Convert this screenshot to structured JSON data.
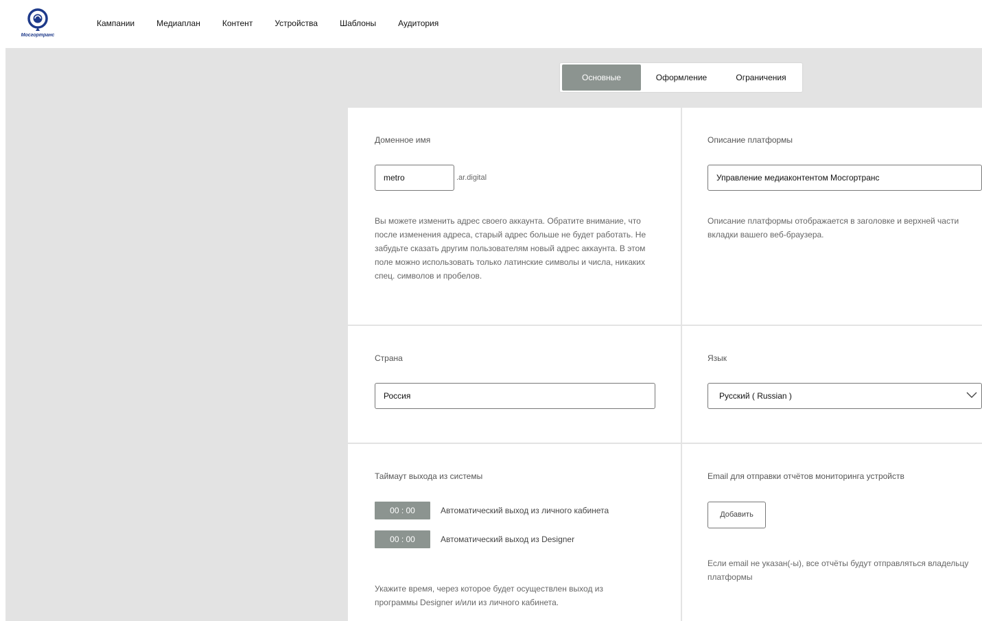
{
  "header": {
    "logo_text": "Мосгортранс",
    "nav": [
      "Кампании",
      "Медиаплан",
      "Контент",
      "Устройства",
      "Шаблоны",
      "Аудитория"
    ]
  },
  "tabs": [
    "Основные",
    "Оформление",
    "Ограничения"
  ],
  "domain": {
    "label": "Доменное имя",
    "value": "metro",
    "suffix": ".ar.digital",
    "help": "Вы можете изменить адрес своего аккаунта. Обратите внимание, что после изменения адреса, старый адрес больше не будет работать. Не забудьте сказать другим пользователям новый адрес аккаунта. В этом поле можно использовать только латинские символы и числа, никаких спец. символов и пробелов."
  },
  "description": {
    "label": "Описание платформы",
    "value": "Управление медиаконтентом Мосгортранс",
    "help": "Описание платформы отображается в заголовке и верхней части вкладки вашего веб-браузера."
  },
  "country": {
    "label": "Страна",
    "value": "Россия"
  },
  "language": {
    "label": "Язык",
    "value": "Русский ( Russian )",
    "icon": "chevron-down-icon"
  },
  "timeout": {
    "label": "Таймаут выхода из системы",
    "rows": [
      {
        "time": "00 : 00",
        "text": "Автоматический выход из личного кабинета"
      },
      {
        "time": "00 : 00",
        "text": "Автоматический выход из Designer"
      }
    ],
    "help": "Укажите время, через которое будет осуществлен выход из программы Designer и/или из личного кабинета."
  },
  "email": {
    "label": "Email для отправки отчётов мониторинга устройств",
    "button": "Добавить",
    "help": "Если email не указан(-ы), все отчёты будут отправляться владельцу платформы"
  },
  "colors": {
    "accent": "#8c9490",
    "background": "#e3e3e3",
    "logo": "#1e3a8a"
  }
}
